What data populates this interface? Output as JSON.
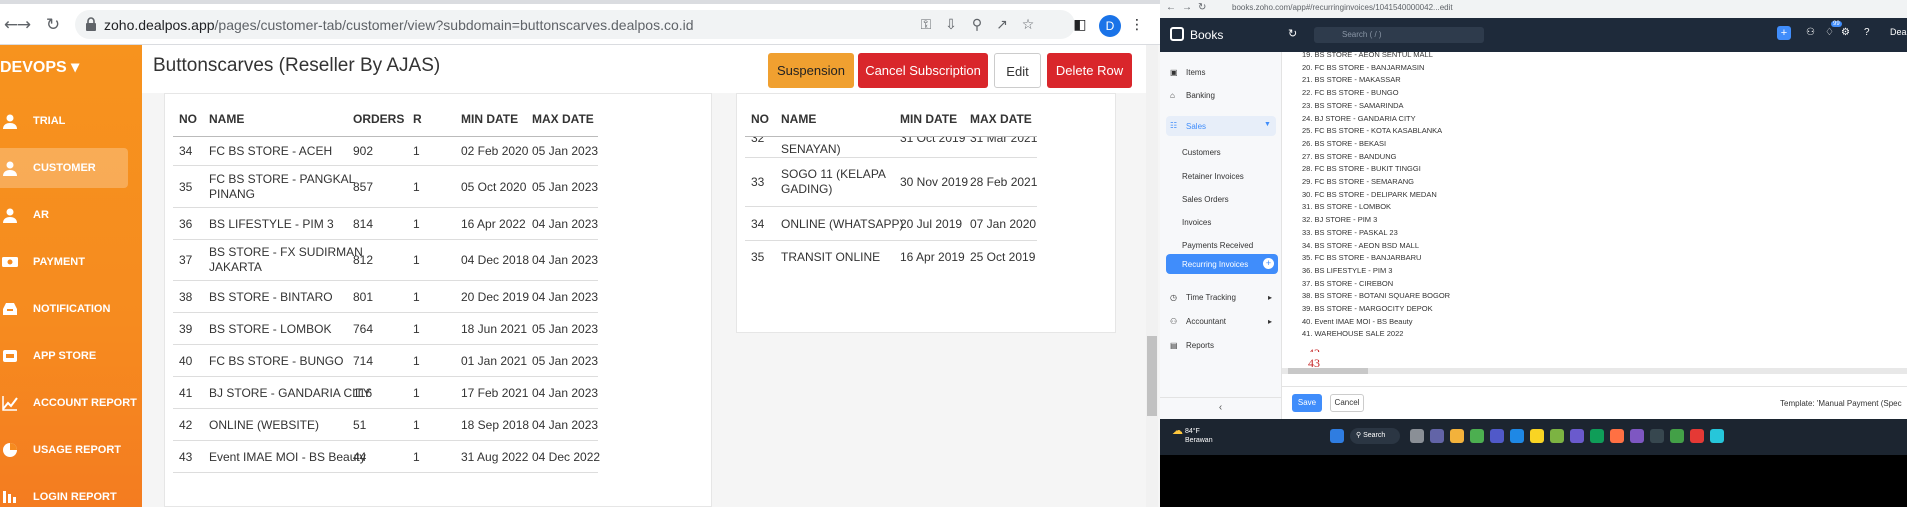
{
  "browser": {
    "url_host": "zoho.dealpos.app",
    "url_path": "/pages/customer-tab/customer/view?subdomain=buttonscarves.dealpos.co.id",
    "profile_initial": "D"
  },
  "sidebar": {
    "brand": "DEVOPS",
    "items": [
      {
        "label": "TRIAL",
        "icon": "user-icon"
      },
      {
        "label": "CUSTOMER",
        "icon": "user-icon"
      },
      {
        "label": "AR",
        "icon": "user-icon"
      },
      {
        "label": "PAYMENT",
        "icon": "money-icon"
      },
      {
        "label": "NOTIFICATION",
        "icon": "inbox-icon"
      },
      {
        "label": "APP STORE",
        "icon": "store-icon"
      },
      {
        "label": "ACCOUNT REPORT",
        "icon": "chart-line-icon"
      },
      {
        "label": "USAGE REPORT",
        "icon": "pie-chart-icon"
      },
      {
        "label": "LOGIN REPORT",
        "icon": "report-icon"
      }
    ]
  },
  "page": {
    "title": "Buttonscarves (Reseller By AJAS)",
    "buttons": {
      "suspension": "Suspension",
      "cancel_subscription": "Cancel Subscription",
      "edit": "Edit",
      "delete_row": "Delete Row"
    }
  },
  "table1": {
    "headers": [
      "NO",
      "NAME",
      "ORDERS",
      "R",
      "MIN DATE",
      "MAX DATE"
    ],
    "rows": [
      {
        "no": "34",
        "name": [
          "FC BS STORE - ACEH"
        ],
        "orders": "902",
        "r": "1",
        "min": "02 Feb 2020",
        "max": "05 Jan 2023"
      },
      {
        "no": "35",
        "name": [
          "FC BS STORE - PANGKAL",
          "PINANG"
        ],
        "orders": "857",
        "r": "1",
        "min": "05 Oct 2020",
        "max": "05 Jan 2023"
      },
      {
        "no": "36",
        "name": [
          "BS LIFESTYLE - PIM 3"
        ],
        "orders": "814",
        "r": "1",
        "min": "16 Apr 2022",
        "max": "04 Jan 2023"
      },
      {
        "no": "37",
        "name": [
          "BS STORE - FX SUDIRMAN",
          "JAKARTA"
        ],
        "orders": "812",
        "r": "1",
        "min": "04 Dec 2018",
        "max": "04 Jan 2023"
      },
      {
        "no": "38",
        "name": [
          "BS STORE - BINTARO"
        ],
        "orders": "801",
        "r": "1",
        "min": "20 Dec 2019",
        "max": "04 Jan 2023"
      },
      {
        "no": "39",
        "name": [
          "BS STORE - LOMBOK"
        ],
        "orders": "764",
        "r": "1",
        "min": "18 Jun 2021",
        "max": "05 Jan 2023"
      },
      {
        "no": "40",
        "name": [
          "FC BS STORE - BUNGO"
        ],
        "orders": "714",
        "r": "1",
        "min": "01 Jan 2021",
        "max": "05 Jan 2023"
      },
      {
        "no": "41",
        "name": [
          "BJ STORE - GANDARIA CITY"
        ],
        "orders": "116",
        "r": "1",
        "min": "17 Feb 2021",
        "max": "04 Jan 2023"
      },
      {
        "no": "42",
        "name": [
          "ONLINE (WEBSITE)"
        ],
        "orders": "51",
        "r": "1",
        "min": "18 Sep 2018",
        "max": "04 Jan 2023"
      },
      {
        "no": "43",
        "name": [
          "Event IMAE MOI - BS Beauty"
        ],
        "orders": "44",
        "r": "1",
        "min": "31 Aug 2022",
        "max": "04 Dec 2022"
      }
    ]
  },
  "table2": {
    "headers": [
      "NO",
      "NAME",
      "MIN DATE",
      "MAX DATE"
    ],
    "partial_row": {
      "no": "32",
      "name": "SENAYAN)",
      "min": "31 Oct 2019",
      "max": "31 Mar 2021"
    },
    "rows": [
      {
        "no": "33",
        "name": [
          "SOGO 11 (KELAPA",
          "GADING)"
        ],
        "min": "30 Nov 2019",
        "max": "28 Feb 2021"
      },
      {
        "no": "34",
        "name": [
          "ONLINE (WHATSAPP)"
        ],
        "min": "20 Jul 2019",
        "max": "07 Jan 2020"
      },
      {
        "no": "35",
        "name": [
          "TRANSIT ONLINE"
        ],
        "min": "16 Apr 2019",
        "max": "25 Oct 2019"
      }
    ]
  },
  "zoho": {
    "url": "books.zoho.com/app#/recurringinvoices/1041540000042...edit",
    "app_name": "Books",
    "search_placeholder": "Search ( / )",
    "notification_count": "99",
    "user_name": "Dea",
    "nav": {
      "items": "Items",
      "banking": "Banking",
      "sales": "Sales",
      "customers": "Customers",
      "retainer_invoices": "Retainer Invoices",
      "sales_orders": "Sales Orders",
      "invoices": "Invoices",
      "payments_received": "Payments Received",
      "recurring_invoices": "Recurring Invoices",
      "time_tracking": "Time Tracking",
      "accountant": "Accountant",
      "reports": "Reports"
    },
    "lines": [
      "19.  BS STORE - AEON SENTUL MALL",
      "20.  FC BS STORE - BANJARMASIN",
      "21.  BS STORE - MAKASSAR",
      "22.  FC BS STORE - BUNGO",
      "23.  BS STORE - SAMARINDA",
      "24.  BJ STORE - GANDARIA CITY",
      "25.  FC BS STORE - KOTA KASABLANKA",
      "26.  BS STORE - BEKASI",
      "27.  BS STORE - BANDUNG",
      "28.  FC BS STORE - BUKIT TINGGI",
      "29.  FC BS STORE - SEMARANG",
      "30.  FC BS STORE - DELIPARK MEDAN",
      "31.  BS STORE - LOMBOK",
      "32.  BJ STORE - PIM 3",
      "33.  BS STORE - PASKAL 23",
      "34.  BS STORE - AEON BSD MALL",
      "35.  FC BS STORE - BANJARBARU",
      "36.  BS LIFESTYLE - PIM 3",
      "37.  BS STORE - CIREBON",
      "38.  BS STORE - BOTANI SQUARE BOGOR",
      "39.  BS STORE - MARGOCITY DEPOK",
      "40.  Event IMAE MOI - BS Beauty",
      "41.  WAREHOUSE SALE 2022"
    ],
    "handwritten": [
      "42",
      "43"
    ],
    "footer": {
      "save": "Save",
      "cancel": "Cancel",
      "template": "Template: 'Manual Payment (Spec"
    }
  },
  "taskbar": {
    "weather_temp": "84°F",
    "weather_desc": "Berawan",
    "search": "Search"
  }
}
